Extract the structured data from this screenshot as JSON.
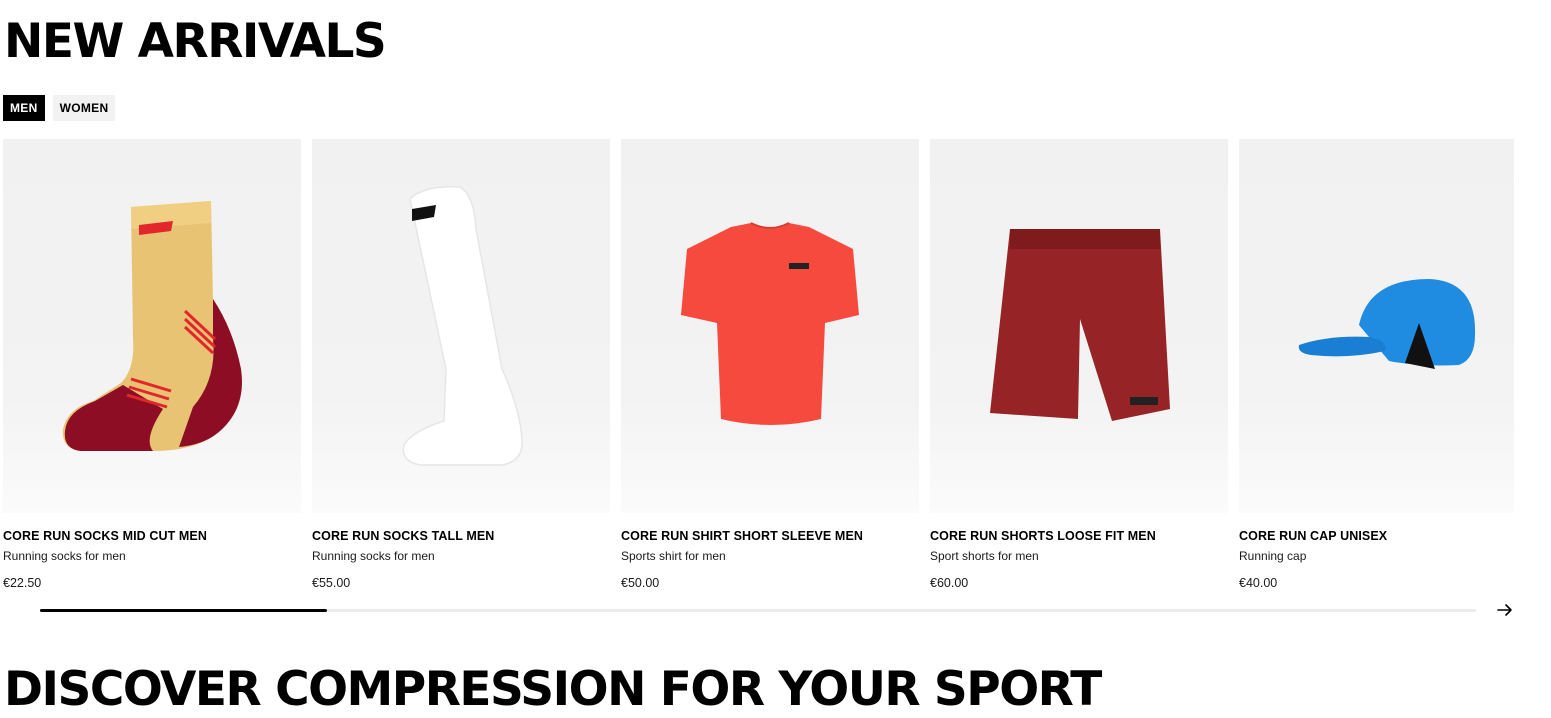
{
  "new_arrivals": {
    "title": "NEW ARRIVALS",
    "tabs": [
      {
        "label": "MEN",
        "active": true
      },
      {
        "label": "WOMEN",
        "active": false
      }
    ],
    "products": [
      {
        "name": "CORE RUN SOCKS MID CUT MEN",
        "description": "Running socks for men",
        "price": "€22.50",
        "image": "sock-mid-cut-yellow-red"
      },
      {
        "name": "CORE RUN SOCKS TALL MEN",
        "description": "Running socks for men",
        "price": "€55.00",
        "image": "sock-tall-white"
      },
      {
        "name": "CORE RUN SHIRT SHORT SLEEVE MEN",
        "description": "Sports shirt for men",
        "price": "€50.00",
        "image": "shirt-red"
      },
      {
        "name": "CORE RUN SHORTS LOOSE FIT MEN",
        "description": "Sport shorts for men",
        "price": "€60.00",
        "image": "shorts-dark-red"
      },
      {
        "name": "CORE RUN CAP UNISEX",
        "description": "Running cap",
        "price": "€40.00",
        "image": "cap-blue"
      }
    ],
    "scroll_progress": 0.2,
    "next_icon": "arrow-right-icon"
  },
  "discover": {
    "title": "DISCOVER COMPRESSION FOR YOUR SPORT"
  },
  "colors": {
    "tab_active_bg": "#000000",
    "tab_inactive_bg": "#f2f2f2",
    "card_bg": "#f2f2f2",
    "scroll_track": "#ececec"
  }
}
